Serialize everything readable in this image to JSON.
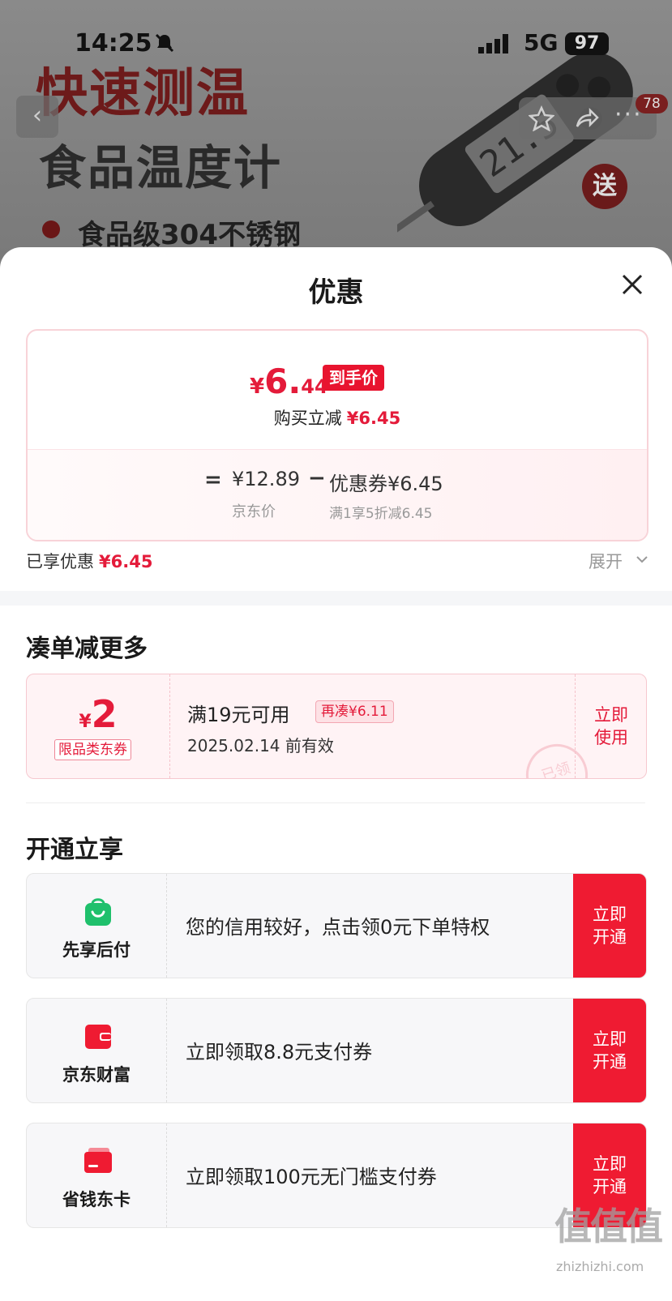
{
  "status_bar": {
    "time": "14:25",
    "network": "5G",
    "battery": "97"
  },
  "hero": {
    "title_line1": "快速测温",
    "title_line2": "食品温度计",
    "feature": "食品级304不锈钢",
    "gift_badge": "送",
    "message_count": "78"
  },
  "sheet": {
    "title": "优惠",
    "price_card": {
      "currency": "¥",
      "final_int": "6.",
      "final_dec": "44",
      "final_tag": "到手价",
      "reduce_label": "购买立减",
      "reduce_amount": "¥6.45",
      "equals": "=",
      "jd_price": "¥12.89",
      "jd_price_label": "京东价",
      "minus": "−",
      "coupon_price": "优惠券¥6.45",
      "coupon_rule": "满1享5折减6.45"
    },
    "enjoyed": {
      "label": "已享优惠",
      "amount": "¥6.45",
      "expand_label": "展开"
    },
    "section_more": {
      "title": "凑单减更多",
      "coupon": {
        "currency": "¥",
        "amount": "2",
        "type": "限品类东券",
        "condition": "满19元可用",
        "need_more": "再凑¥6.11",
        "expiry": "2025.02.14 前有效",
        "stamp": "已领",
        "use_label": "立即使用"
      }
    },
    "section_open": {
      "title": "开通立享",
      "cards": [
        {
          "name": "先享后付",
          "icon": "bag-icon",
          "desc": "您的信用较好，点击领0元下单特权",
          "button": "立即开通",
          "icon_color": "#1fc06c"
        },
        {
          "name": "京东财富",
          "icon": "wallet-icon",
          "desc": "立即领取8.8元支付券",
          "button": "立即开通",
          "icon_color": "#ef1b32"
        },
        {
          "name": "省钱东卡",
          "icon": "card-icon",
          "desc": "立即领取100元无门槛支付券",
          "button": "立即开通",
          "icon_color": "#ef1b32"
        }
      ]
    }
  },
  "watermark": {
    "glyphs": "值值值",
    "url": "zhizhizhi.com"
  },
  "colors": {
    "accent": "#e41b3a",
    "button": "#ef1b32",
    "green": "#1fc06c"
  }
}
